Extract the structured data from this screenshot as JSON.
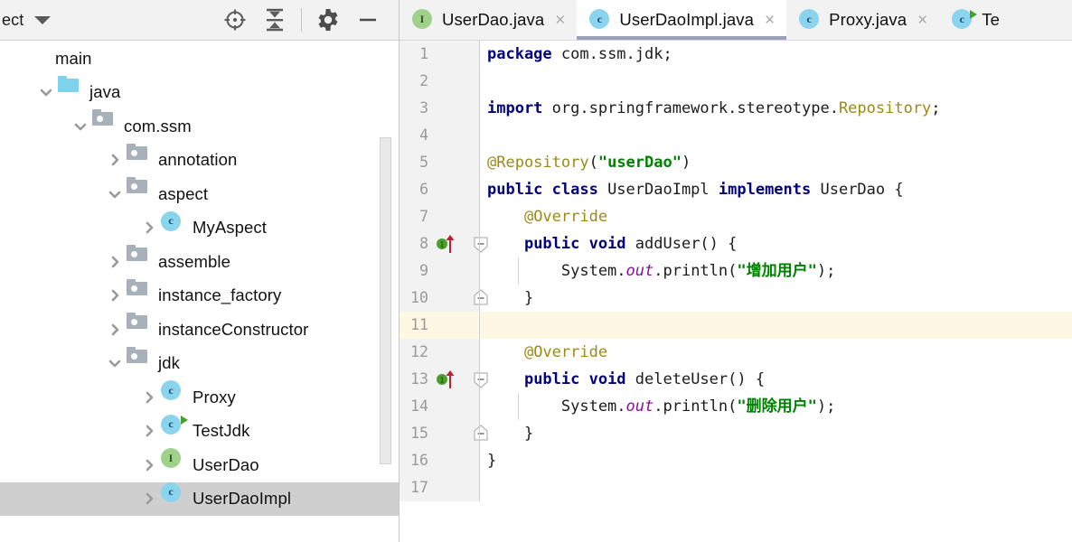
{
  "project_panel": {
    "title": "ect",
    "toolbar_actions": [
      {
        "name": "locate-in-tree-icon",
        "label": "Select Opened File"
      },
      {
        "name": "collapse-all-icon",
        "label": "Collapse All"
      },
      {
        "name": "gear-icon",
        "label": "Settings"
      },
      {
        "name": "minimize-icon",
        "label": "Hide"
      }
    ],
    "tree": [
      {
        "label": "main",
        "depth": 0,
        "arrow": "none",
        "icon": "module-square",
        "selected": false
      },
      {
        "label": "java",
        "depth": 1,
        "arrow": "expanded",
        "icon": "folder-source",
        "selected": false
      },
      {
        "label": "com.ssm",
        "depth": 2,
        "arrow": "expanded",
        "icon": "folder-package",
        "selected": false
      },
      {
        "label": "annotation",
        "depth": 3,
        "arrow": "collapsed",
        "icon": "folder-package",
        "selected": false
      },
      {
        "label": "aspect",
        "depth": 3,
        "arrow": "expanded",
        "icon": "folder-package",
        "selected": false
      },
      {
        "label": "MyAspect",
        "depth": 4,
        "arrow": "collapsed",
        "icon": "class",
        "selected": false
      },
      {
        "label": "assemble",
        "depth": 3,
        "arrow": "collapsed",
        "icon": "folder-package",
        "selected": false
      },
      {
        "label": "instance_factory",
        "depth": 3,
        "arrow": "collapsed",
        "icon": "folder-package",
        "selected": false
      },
      {
        "label": "instanceConstructor",
        "depth": 3,
        "arrow": "collapsed",
        "icon": "folder-package",
        "selected": false
      },
      {
        "label": "jdk",
        "depth": 3,
        "arrow": "expanded",
        "icon": "folder-package",
        "selected": false
      },
      {
        "label": "Proxy",
        "depth": 4,
        "arrow": "collapsed",
        "icon": "class",
        "selected": false
      },
      {
        "label": "TestJdk",
        "depth": 4,
        "arrow": "collapsed",
        "icon": "class-runnable",
        "selected": false
      },
      {
        "label": "UserDao",
        "depth": 4,
        "arrow": "collapsed",
        "icon": "interface",
        "selected": false
      },
      {
        "label": "UserDaoImpl",
        "depth": 4,
        "arrow": "collapsed",
        "icon": "class",
        "selected": true
      }
    ]
  },
  "editor": {
    "tabs": [
      {
        "label": "UserDao.java",
        "icon": "interface",
        "active": false,
        "close": "×"
      },
      {
        "label": "UserDaoImpl.java",
        "icon": "class",
        "active": true,
        "close": "×"
      },
      {
        "label": "Proxy.java",
        "icon": "class",
        "active": false,
        "close": "×"
      },
      {
        "label": "Te",
        "icon": "class-runnable",
        "active": false,
        "close": ""
      }
    ],
    "caret_line": 11,
    "lines": [
      {
        "n": 1,
        "mark": "",
        "fold": "",
        "indent": false,
        "tokens": [
          {
            "t": "package ",
            "c": "k"
          },
          {
            "t": "com.ssm.jdk;",
            "c": "p"
          }
        ]
      },
      {
        "n": 2,
        "mark": "",
        "fold": "",
        "indent": false,
        "tokens": []
      },
      {
        "n": 3,
        "mark": "",
        "fold": "",
        "indent": false,
        "tokens": [
          {
            "t": "import ",
            "c": "k"
          },
          {
            "t": "org.springframework.stereotype.",
            "c": "p"
          },
          {
            "t": "Repository",
            "c": "t"
          },
          {
            "t": ";",
            "c": "p"
          }
        ]
      },
      {
        "n": 4,
        "mark": "",
        "fold": "",
        "indent": false,
        "tokens": []
      },
      {
        "n": 5,
        "mark": "",
        "fold": "",
        "indent": false,
        "tokens": [
          {
            "t": "@Repository",
            "c": "an"
          },
          {
            "t": "(",
            "c": "p"
          },
          {
            "t": "\"userDao\"",
            "c": "s"
          },
          {
            "t": ")",
            "c": "p"
          }
        ]
      },
      {
        "n": 6,
        "mark": "",
        "fold": "",
        "indent": false,
        "tokens": [
          {
            "t": "public class ",
            "c": "k"
          },
          {
            "t": "UserDaoImpl ",
            "c": "p"
          },
          {
            "t": "implements ",
            "c": "k"
          },
          {
            "t": "UserDao {",
            "c": "p"
          }
        ]
      },
      {
        "n": 7,
        "mark": "",
        "fold": "",
        "indent": false,
        "tokens": [
          {
            "t": "    ",
            "c": "p"
          },
          {
            "t": "@Override",
            "c": "an"
          }
        ]
      },
      {
        "n": 8,
        "mark": "implements",
        "fold": "open",
        "indent": false,
        "tokens": [
          {
            "t": "    ",
            "c": "p"
          },
          {
            "t": "public void ",
            "c": "k"
          },
          {
            "t": "addUser() {",
            "c": "p"
          }
        ]
      },
      {
        "n": 9,
        "mark": "",
        "fold": "",
        "indent": true,
        "tokens": [
          {
            "t": "        System.",
            "c": "p"
          },
          {
            "t": "out",
            "c": "f"
          },
          {
            "t": ".println(",
            "c": "p"
          },
          {
            "t": "\"增加用户\"",
            "c": "s"
          },
          {
            "t": ");",
            "c": "p"
          }
        ]
      },
      {
        "n": 10,
        "mark": "",
        "fold": "close",
        "indent": false,
        "tokens": [
          {
            "t": "    }",
            "c": "p"
          }
        ]
      },
      {
        "n": 11,
        "mark": "",
        "fold": "",
        "indent": false,
        "tokens": []
      },
      {
        "n": 12,
        "mark": "",
        "fold": "",
        "indent": false,
        "tokens": [
          {
            "t": "    ",
            "c": "p"
          },
          {
            "t": "@Override",
            "c": "an"
          }
        ]
      },
      {
        "n": 13,
        "mark": "implements",
        "fold": "open",
        "indent": false,
        "tokens": [
          {
            "t": "    ",
            "c": "p"
          },
          {
            "t": "public void ",
            "c": "k"
          },
          {
            "t": "deleteUser() {",
            "c": "p"
          }
        ]
      },
      {
        "n": 14,
        "mark": "",
        "fold": "",
        "indent": true,
        "tokens": [
          {
            "t": "        System.",
            "c": "p"
          },
          {
            "t": "out",
            "c": "f"
          },
          {
            "t": ".println(",
            "c": "p"
          },
          {
            "t": "\"删除用户\"",
            "c": "s"
          },
          {
            "t": ");",
            "c": "p"
          }
        ]
      },
      {
        "n": 15,
        "mark": "",
        "fold": "close",
        "indent": false,
        "tokens": [
          {
            "t": "    }",
            "c": "p"
          }
        ]
      },
      {
        "n": 16,
        "mark": "",
        "fold": "",
        "indent": false,
        "tokens": [
          {
            "t": "}",
            "c": "p"
          }
        ]
      },
      {
        "n": 17,
        "mark": "",
        "fold": "",
        "indent": false,
        "tokens": []
      }
    ],
    "gutter_marker_badge": "1"
  },
  "colors": {
    "keyword": "#000080",
    "string": "#008000",
    "annotation": "#9a8a16",
    "field_static": "#871094",
    "caret_line_bg": "#fdf8e3",
    "selection_bg": "#cfcfcf",
    "active_tab_underline": "#9aa0bb"
  }
}
